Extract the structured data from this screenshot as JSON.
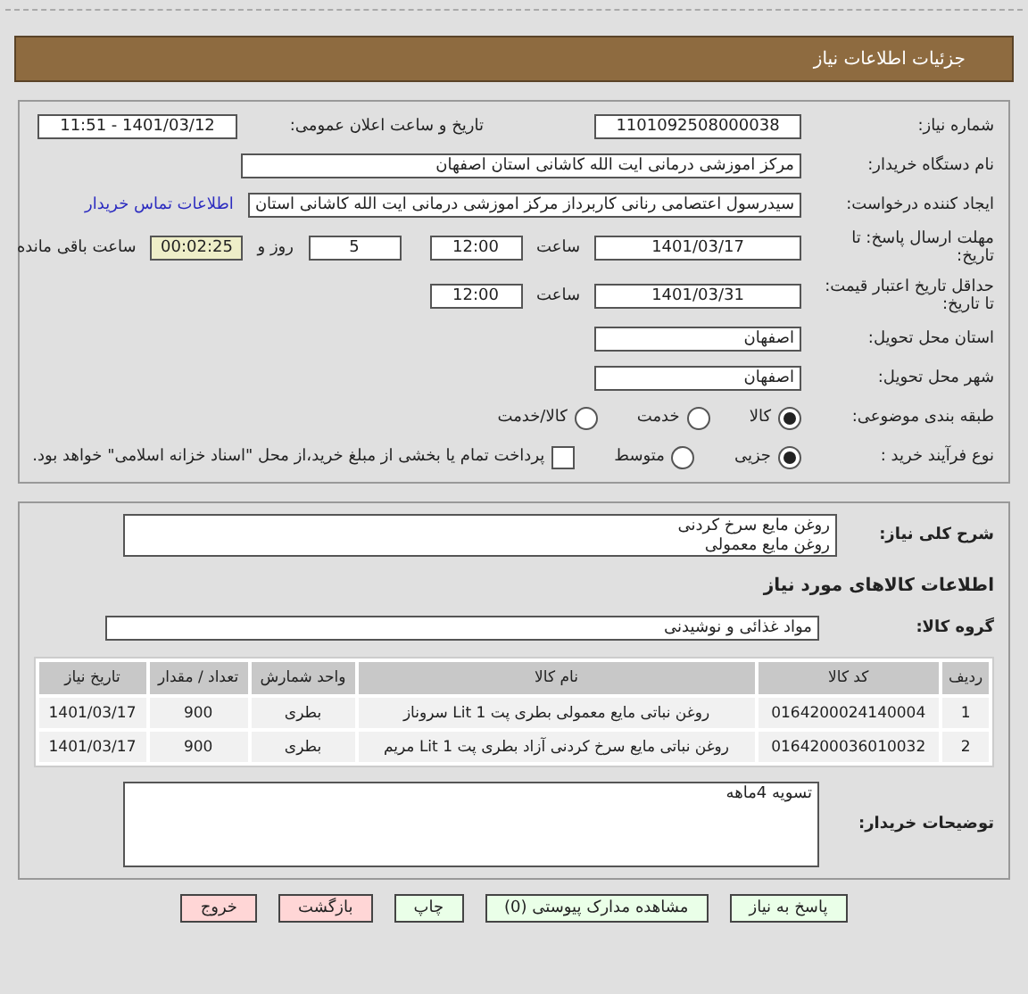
{
  "header": {
    "title": "جزئیات اطلاعات نیاز"
  },
  "need": {
    "number_label": "شماره نیاز:",
    "number": "1101092508000038",
    "announce_label": "تاریخ و ساعت اعلان عمومی:",
    "announce": "1401/03/12 - 11:51"
  },
  "buyer": {
    "label": "نام دستگاه خریدار:",
    "value": "مرکز اموزشی درمانی ایت الله کاشانی استان اصفهان"
  },
  "creator": {
    "label": "ایجاد کننده درخواست:",
    "value": "سیدرسول اعتصامی رنانی کاربرداز مرکز اموزشی درمانی ایت الله کاشانی استان",
    "link": "اطلاعات تماس خریدار"
  },
  "deadline": {
    "label": "مهلت ارسال پاسخ: تا تاریخ:",
    "date": "1401/03/17",
    "time_label": "ساعت",
    "time": "12:00",
    "days": "5",
    "days_label": "روز و",
    "remaining": "00:02:25",
    "remaining_label": "ساعت باقی مانده"
  },
  "validity": {
    "label": "حداقل تاریخ اعتبار قیمت: تا تاریخ:",
    "date": "1401/03/31",
    "time_label": "ساعت",
    "time": "12:00"
  },
  "province": {
    "label": "استان محل تحویل:",
    "value": "اصفهان"
  },
  "city": {
    "label": "شهر محل تحویل:",
    "value": "اصفهان"
  },
  "category": {
    "label": "طبقه بندی موضوعی:",
    "options": [
      {
        "label": "کالا",
        "selected": true
      },
      {
        "label": "خدمت",
        "selected": false
      },
      {
        "label": "کالا/خدمت",
        "selected": false
      }
    ]
  },
  "process": {
    "label": "نوع فرآیند خرید :",
    "options": [
      {
        "label": "جزیی",
        "selected": true
      },
      {
        "label": "متوسط",
        "selected": false
      }
    ],
    "treasury": {
      "checked": false,
      "text": "پرداخت تمام یا بخشی از مبلغ خرید،از محل \"اسناد خزانه اسلامی\" خواهد بود."
    }
  },
  "description": {
    "label": "شرح کلی نیاز:",
    "lines": [
      "روغن مایع سرخ کردنی",
      "روغن مایع معمولی"
    ]
  },
  "goods_title": "اطلاعات کالاهای مورد نیاز",
  "goods_group": {
    "label": "گروه کالا:",
    "value": "مواد غذائی و نوشیدنی"
  },
  "table": {
    "columns": [
      "ردیف",
      "کد کالا",
      "نام کالا",
      "واحد شمارش",
      "تعداد / مقدار",
      "تاریخ نیاز"
    ],
    "rows": [
      [
        "1",
        "0164200024140004",
        "روغن نباتی مایع معمولی بطری پت 1 Lit سروناز",
        "بطری",
        "900",
        "1401/03/17"
      ],
      [
        "2",
        "0164200036010032",
        "روغن نباتی مایع سرخ کردنی آزاد بطری پت 1 Lit مریم",
        "بطری",
        "900",
        "1401/03/17"
      ]
    ]
  },
  "notes": {
    "label": "توضیحات خریدار:",
    "value": "تسویه 4ماهه"
  },
  "buttons": [
    {
      "label": "پاسخ به نیاز",
      "kind": "normal"
    },
    {
      "label": "مشاهده مدارک پیوستی (0)",
      "kind": "normal"
    },
    {
      "label": "چاپ",
      "kind": "normal"
    },
    {
      "label": "بازگشت",
      "kind": "danger"
    },
    {
      "label": "خروج",
      "kind": "danger"
    }
  ]
}
